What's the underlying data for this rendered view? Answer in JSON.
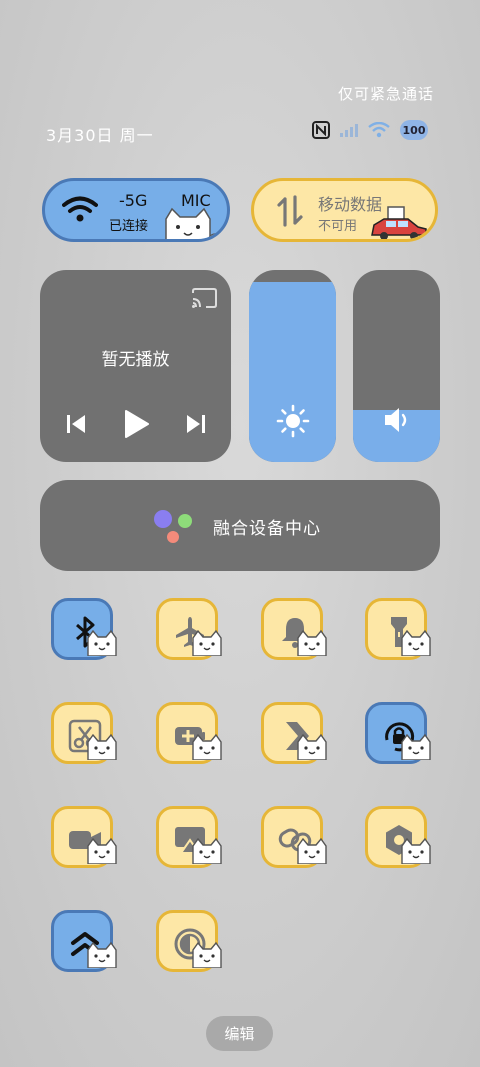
{
  "status": {
    "emergency_text": "仅可紧急通话",
    "date": "3月30日 周一",
    "battery": "100"
  },
  "wifi": {
    "ssid": "-5G",
    "ssid_extra": "MIC",
    "status": "已连接",
    "state": "on"
  },
  "mobile_data": {
    "label": "移动数据",
    "status": "不可用",
    "state": "off"
  },
  "media": {
    "title": "暂无播放"
  },
  "sliders": {
    "brightness_level": 0.94,
    "volume_level": 0.27
  },
  "device_center": {
    "label": "融合设备中心"
  },
  "tiles": [
    {
      "name": "bluetooth",
      "icon": "bluetooth-icon",
      "state": "on"
    },
    {
      "name": "airplane-mode",
      "icon": "airplane-icon",
      "state": "off"
    },
    {
      "name": "ring-mode",
      "icon": "bell-icon",
      "state": "off"
    },
    {
      "name": "flashlight",
      "icon": "flashlight-icon",
      "state": "off"
    },
    {
      "name": "screenshot",
      "icon": "scissors-icon",
      "state": "off"
    },
    {
      "name": "battery-saver",
      "icon": "battery-plus-icon",
      "state": "off"
    },
    {
      "name": "transfer",
      "icon": "chevrons-icon",
      "state": "off"
    },
    {
      "name": "rotation-lock",
      "icon": "rotation-lock-icon",
      "state": "on"
    },
    {
      "name": "screen-record",
      "icon": "video-camera-icon",
      "state": "off"
    },
    {
      "name": "screen-cast",
      "icon": "cast-screen-icon",
      "state": "off"
    },
    {
      "name": "link",
      "icon": "link-icon",
      "state": "off"
    },
    {
      "name": "settings",
      "icon": "hexagon-nut-icon",
      "state": "off"
    },
    {
      "name": "performance",
      "icon": "double-chevron-up-icon",
      "state": "on"
    },
    {
      "name": "dark-mode",
      "icon": "contrast-icon",
      "state": "off"
    }
  ],
  "edit_button": "编辑",
  "colors": {
    "tile_on": "#77aee8",
    "tile_on_border": "#4a79b6",
    "tile_off": "#fde7a6",
    "tile_off_border": "#e6b637",
    "panel": "#717171",
    "slider_fill": "#79aeea"
  }
}
